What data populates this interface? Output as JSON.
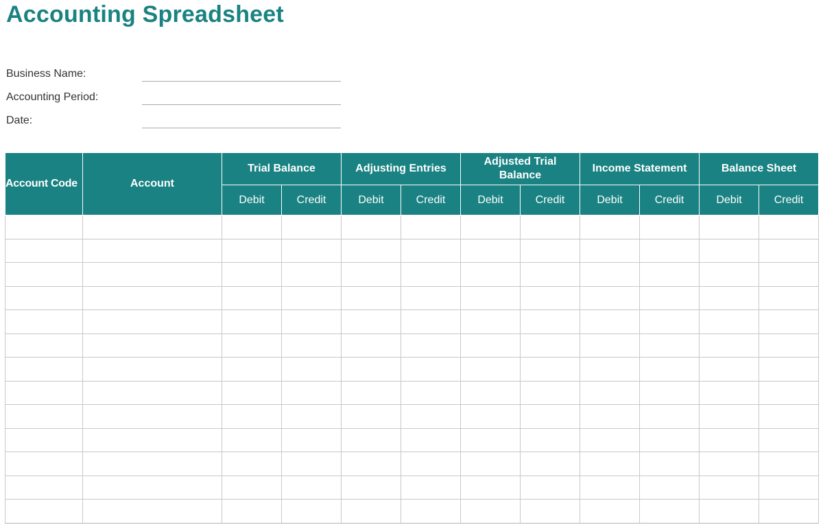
{
  "title": "Accounting Spreadsheet",
  "info": {
    "business_name_label": "Business Name:",
    "business_name_value": "",
    "accounting_period_label": "Accounting Period:",
    "accounting_period_value": "",
    "date_label": "Date:",
    "date_value": ""
  },
  "table": {
    "account_code_header": "Account Code",
    "account_header": "Account",
    "groups": [
      {
        "label": "Trial Balance"
      },
      {
        "label": "Adjusting Entries"
      },
      {
        "label": "Adjusted Trial Balance"
      },
      {
        "label": "Income Statement"
      },
      {
        "label": "Balance Sheet"
      }
    ],
    "debit_label": "Debit",
    "credit_label": "Credit",
    "rows": [
      {
        "code": "",
        "account": "",
        "values": [
          "",
          "",
          "",
          "",
          "",
          "",
          "",
          "",
          "",
          ""
        ]
      },
      {
        "code": "",
        "account": "",
        "values": [
          "",
          "",
          "",
          "",
          "",
          "",
          "",
          "",
          "",
          ""
        ]
      },
      {
        "code": "",
        "account": "",
        "values": [
          "",
          "",
          "",
          "",
          "",
          "",
          "",
          "",
          "",
          ""
        ]
      },
      {
        "code": "",
        "account": "",
        "values": [
          "",
          "",
          "",
          "",
          "",
          "",
          "",
          "",
          "",
          ""
        ]
      },
      {
        "code": "",
        "account": "",
        "values": [
          "",
          "",
          "",
          "",
          "",
          "",
          "",
          "",
          "",
          ""
        ]
      },
      {
        "code": "",
        "account": "",
        "values": [
          "",
          "",
          "",
          "",
          "",
          "",
          "",
          "",
          "",
          ""
        ]
      },
      {
        "code": "",
        "account": "",
        "values": [
          "",
          "",
          "",
          "",
          "",
          "",
          "",
          "",
          "",
          ""
        ]
      },
      {
        "code": "",
        "account": "",
        "values": [
          "",
          "",
          "",
          "",
          "",
          "",
          "",
          "",
          "",
          ""
        ]
      },
      {
        "code": "",
        "account": "",
        "values": [
          "",
          "",
          "",
          "",
          "",
          "",
          "",
          "",
          "",
          ""
        ]
      },
      {
        "code": "",
        "account": "",
        "values": [
          "",
          "",
          "",
          "",
          "",
          "",
          "",
          "",
          "",
          ""
        ]
      },
      {
        "code": "",
        "account": "",
        "values": [
          "",
          "",
          "",
          "",
          "",
          "",
          "",
          "",
          "",
          ""
        ]
      },
      {
        "code": "",
        "account": "",
        "values": [
          "",
          "",
          "",
          "",
          "",
          "",
          "",
          "",
          "",
          ""
        ]
      },
      {
        "code": "",
        "account": "",
        "values": [
          "",
          "",
          "",
          "",
          "",
          "",
          "",
          "",
          "",
          ""
        ]
      }
    ]
  },
  "colors": {
    "accent": "#1a8282",
    "header_text": "#ffffff",
    "grid_line": "#c8c8c8"
  }
}
